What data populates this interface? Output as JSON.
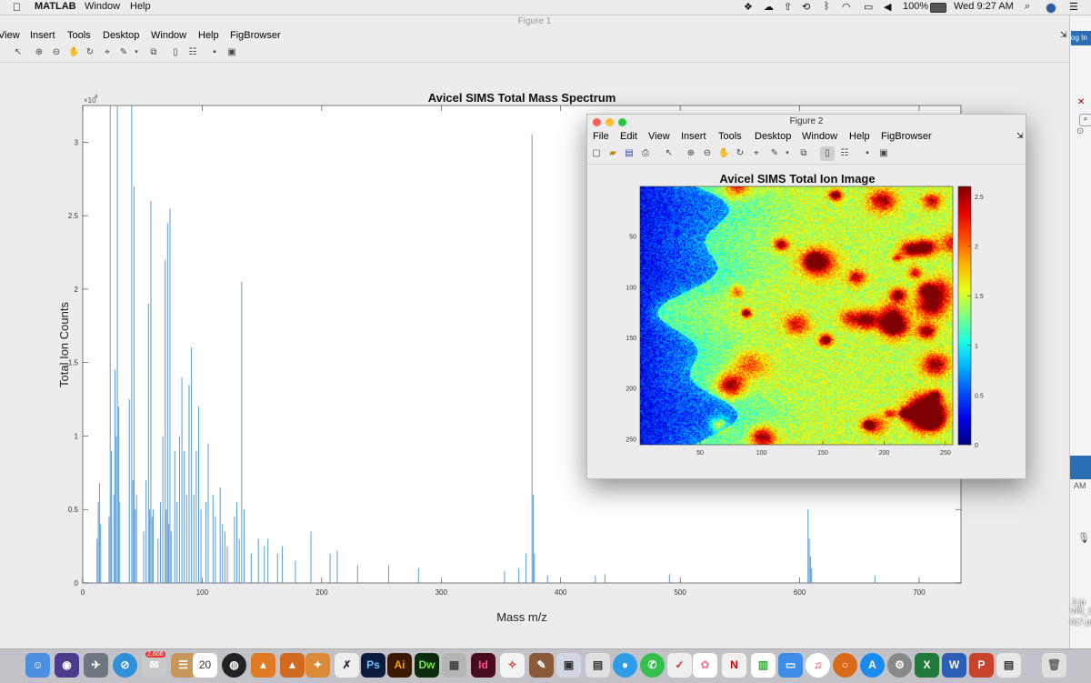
{
  "menubar": {
    "app": "MATLAB",
    "items": [
      "Window",
      "Help"
    ],
    "battery": "100%",
    "clock": "Wed 9:27 AM"
  },
  "figure1": {
    "title": "Figure 1",
    "menu": [
      "View",
      "Insert",
      "Tools",
      "Desktop",
      "Window",
      "Help",
      "FigBrowser"
    ]
  },
  "figure2": {
    "title": "Figure 2",
    "menu": [
      "File",
      "Edit",
      "View",
      "Insert",
      "Tools",
      "Desktop",
      "Window",
      "Help",
      "FigBrowser"
    ]
  },
  "rightstrip": {
    "login": "og In",
    "text1": "AM",
    "text2": "2.jp",
    "text3": "VRI_O",
    "text4": "017.pd"
  },
  "dock": {
    "calendar_day": "20",
    "badge": "2,606",
    "apps": [
      "Ps",
      "Ai",
      "Dw",
      "Id"
    ]
  },
  "chart_data": [
    {
      "type": "line",
      "title": "Avicel SIMS Total Mass Spectrum",
      "xlabel": "Mass m/z",
      "ylabel": "Total Ion Counts",
      "y_exponent": "×10",
      "y_exponent_power": "4",
      "xlim": [
        0,
        735
      ],
      "ylim": [
        0,
        3.25
      ],
      "xticks": [
        "0",
        "100",
        "200",
        "300",
        "400",
        "500",
        "600",
        "700"
      ],
      "yticks": [
        "0",
        "0.5",
        "1",
        "1.5",
        "2",
        "2.5",
        "3"
      ],
      "series_color": "#5b9bd5",
      "peaks": [
        {
          "x": 12,
          "y": 0.3
        },
        {
          "x": 13,
          "y": 0.55
        },
        {
          "x": 14,
          "y": 0.68
        },
        {
          "x": 15,
          "y": 0.4
        },
        {
          "x": 22,
          "y": 0.45
        },
        {
          "x": 23,
          "y": 3.25
        },
        {
          "x": 24,
          "y": 0.9
        },
        {
          "x": 26,
          "y": 0.6
        },
        {
          "x": 27,
          "y": 1.45
        },
        {
          "x": 28,
          "y": 1.0
        },
        {
          "x": 29,
          "y": 3.25
        },
        {
          "x": 30,
          "y": 1.2
        },
        {
          "x": 31,
          "y": 0.55
        },
        {
          "x": 39,
          "y": 1.25
        },
        {
          "x": 41,
          "y": 3.25
        },
        {
          "x": 42,
          "y": 0.7
        },
        {
          "x": 43,
          "y": 2.7
        },
        {
          "x": 44,
          "y": 0.5
        },
        {
          "x": 45,
          "y": 0.6
        },
        {
          "x": 51,
          "y": 0.35
        },
        {
          "x": 53,
          "y": 0.7
        },
        {
          "x": 55,
          "y": 1.9
        },
        {
          "x": 56,
          "y": 0.5
        },
        {
          "x": 57,
          "y": 2.6
        },
        {
          "x": 58,
          "y": 0.45
        },
        {
          "x": 59,
          "y": 0.5
        },
        {
          "x": 63,
          "y": 0.3
        },
        {
          "x": 65,
          "y": 0.55
        },
        {
          "x": 67,
          "y": 1.0
        },
        {
          "x": 69,
          "y": 2.2
        },
        {
          "x": 70,
          "y": 0.5
        },
        {
          "x": 71,
          "y": 2.45
        },
        {
          "x": 72,
          "y": 0.4
        },
        {
          "x": 73,
          "y": 2.55
        },
        {
          "x": 74,
          "y": 0.35
        },
        {
          "x": 77,
          "y": 0.9
        },
        {
          "x": 79,
          "y": 0.55
        },
        {
          "x": 81,
          "y": 1.0
        },
        {
          "x": 83,
          "y": 1.4
        },
        {
          "x": 85,
          "y": 0.9
        },
        {
          "x": 87,
          "y": 0.6
        },
        {
          "x": 89,
          "y": 1.35
        },
        {
          "x": 91,
          "y": 1.6
        },
        {
          "x": 93,
          "y": 0.6
        },
        {
          "x": 95,
          "y": 0.9
        },
        {
          "x": 97,
          "y": 1.2
        },
        {
          "x": 99,
          "y": 0.5
        },
        {
          "x": 103,
          "y": 0.55
        },
        {
          "x": 105,
          "y": 0.95
        },
        {
          "x": 109,
          "y": 0.6
        },
        {
          "x": 111,
          "y": 0.45
        },
        {
          "x": 115,
          "y": 0.65
        },
        {
          "x": 117,
          "y": 0.4
        },
        {
          "x": 119,
          "y": 0.35
        },
        {
          "x": 121,
          "y": 0.25
        },
        {
          "x": 127,
          "y": 0.45
        },
        {
          "x": 129,
          "y": 0.55
        },
        {
          "x": 131,
          "y": 0.3
        },
        {
          "x": 133,
          "y": 2.05
        },
        {
          "x": 135,
          "y": 0.5
        },
        {
          "x": 141,
          "y": 0.2
        },
        {
          "x": 147,
          "y": 0.3
        },
        {
          "x": 152,
          "y": 0.25
        },
        {
          "x": 155,
          "y": 0.3
        },
        {
          "x": 163,
          "y": 0.2
        },
        {
          "x": 167,
          "y": 0.25
        },
        {
          "x": 178,
          "y": 0.15
        },
        {
          "x": 191,
          "y": 0.35
        },
        {
          "x": 207,
          "y": 0.2
        },
        {
          "x": 213,
          "y": 0.22
        },
        {
          "x": 230,
          "y": 0.12
        },
        {
          "x": 256,
          "y": 0.12
        },
        {
          "x": 281,
          "y": 0.1
        },
        {
          "x": 353,
          "y": 0.08
        },
        {
          "x": 365,
          "y": 0.1
        },
        {
          "x": 371,
          "y": 0.2
        },
        {
          "x": 376,
          "y": 3.05
        },
        {
          "x": 377,
          "y": 0.6
        },
        {
          "x": 378,
          "y": 0.2
        },
        {
          "x": 389,
          "y": 0.05
        },
        {
          "x": 429,
          "y": 0.05
        },
        {
          "x": 437,
          "y": 0.06
        },
        {
          "x": 491,
          "y": 0.06
        },
        {
          "x": 607,
          "y": 0.5
        },
        {
          "x": 608,
          "y": 0.3
        },
        {
          "x": 609,
          "y": 0.18
        },
        {
          "x": 610,
          "y": 0.1
        },
        {
          "x": 663,
          "y": 0.05
        }
      ]
    },
    {
      "type": "heatmap",
      "title": "Avicel SIMS Total Ion Image",
      "xlim": [
        1,
        256
      ],
      "ylim": [
        1,
        256
      ],
      "xticks": [
        "50",
        "100",
        "150",
        "200",
        "250"
      ],
      "yticks": [
        "50",
        "100",
        "150",
        "200",
        "250"
      ],
      "colorbar_ticks": [
        "0",
        "0.5",
        "1",
        "1.5",
        "2",
        "2.5"
      ],
      "colorbar_range": [
        0,
        2.6
      ],
      "colormap": "jet"
    }
  ]
}
